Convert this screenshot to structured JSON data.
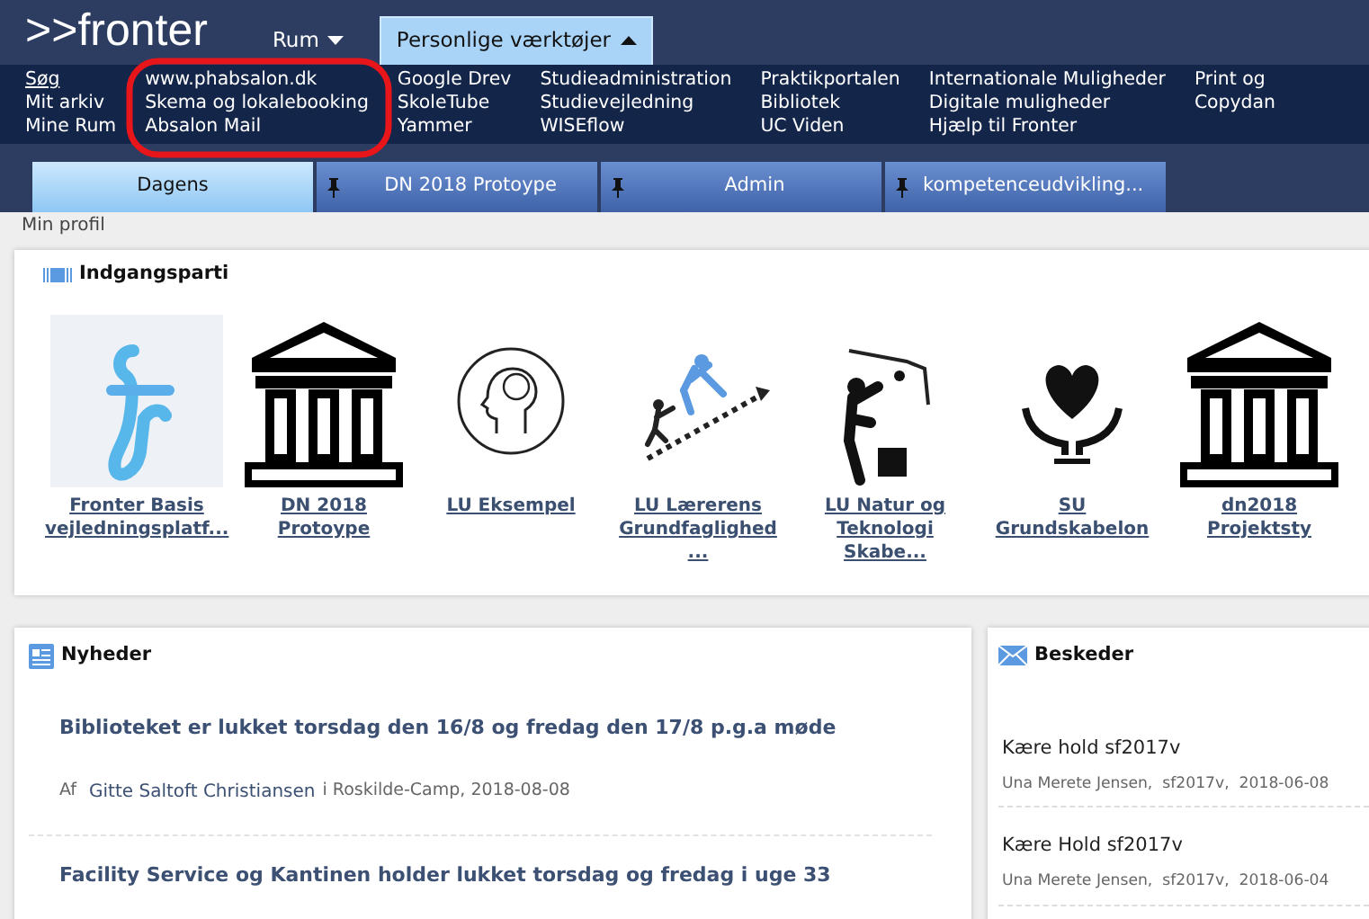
{
  "header": {
    "logo": ">>fronter",
    "menus": [
      {
        "label": "Rum",
        "expanded": false
      },
      {
        "label": "Personlige værktøjer",
        "expanded": true
      }
    ]
  },
  "quick_links": [
    [
      "Søg",
      "Mit arkiv",
      "Mine Rum"
    ],
    [
      "www.phabsalon.dk",
      "Skema og lokalebooking",
      "Absalon Mail"
    ],
    [
      "Google Drev",
      "SkoleTube",
      "Yammer"
    ],
    [
      "Studieadministration",
      "Studievejledning",
      "WISEflow"
    ],
    [
      "Praktikportalen",
      "Bibliotek",
      "UC Viden"
    ],
    [
      "Internationale Muligheder",
      "Digitale muligheder",
      "Hjælp til Fronter"
    ],
    [
      "Print og",
      "Copydan"
    ]
  ],
  "tabs": [
    {
      "label": "Dagens",
      "selected": true,
      "pinned": false
    },
    {
      "label": "DN 2018 Protoype",
      "selected": false,
      "pinned": true
    },
    {
      "label": "Admin",
      "selected": false,
      "pinned": true
    },
    {
      "label": "kompetenceudvikling...",
      "selected": false,
      "pinned": true
    }
  ],
  "profile_link": "Min profil",
  "entrance": {
    "title": "Indgangsparti",
    "items": [
      {
        "label": "Fronter Basis vejledningsplatf...",
        "kind": "fronter"
      },
      {
        "label": "DN 2018 Protoype",
        "kind": "temple"
      },
      {
        "label": "LU Eksempel",
        "kind": "head"
      },
      {
        "label": "LU Lærerens Grundfaglighed ...",
        "kind": "climb"
      },
      {
        "label": "LU Natur og Teknologi Skabe...",
        "kind": "gardener"
      },
      {
        "label": "SU Grundskabelon",
        "kind": "heart"
      },
      {
        "label": "dn2018 Projektsty",
        "kind": "temple"
      }
    ]
  },
  "news": {
    "title": "Nyheder",
    "items": [
      {
        "title": "Biblioteket er lukket torsdag den 16/8 og fredag den 17/8 p.g.a møde",
        "prefix": "Af",
        "author": "Gitte Saltoft Christiansen",
        "place": "i Roskilde-Camp, 2018-08-08"
      },
      {
        "title": "Facility Service og Kantinen holder lukket torsdag og fredag i uge 33"
      }
    ]
  },
  "messages": {
    "title": "Beskeder",
    "items": [
      {
        "subject": "Kære hold sf2017v",
        "meta": "Una Merete Jensen,  sf2017v,  2018-06-08"
      },
      {
        "subject": "Kære Hold sf2017v",
        "meta": "Una Merete Jensen,  sf2017v,  2018-06-04"
      }
    ]
  },
  "annotation": {
    "kind": "ellipse",
    "color": "#e8151b"
  }
}
